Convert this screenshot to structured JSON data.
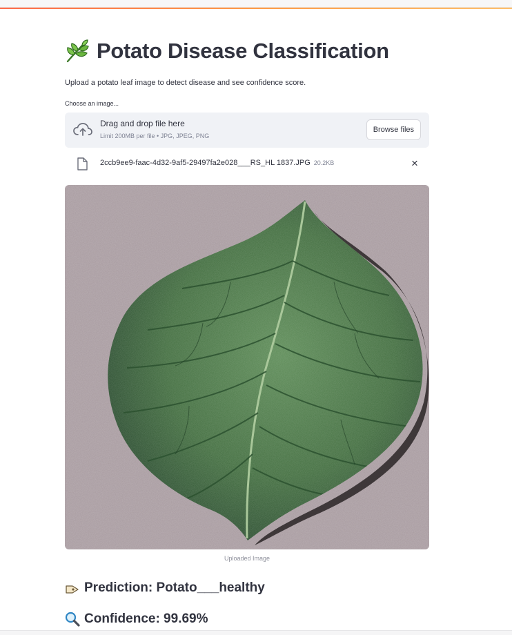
{
  "page": {
    "title": "Potato Disease Classification",
    "title_icon": "herb-leaf-emoji",
    "subtitle": "Upload a potato leaf image to detect disease and see confidence score."
  },
  "uploader": {
    "label": "Choose an image...",
    "dropzone_title": "Drag and drop file here",
    "limit_text": "Limit 200MB per file • JPG, JPEG, PNG",
    "browse_label": "Browse files",
    "cloud_icon": "cloud-upload-icon",
    "file": {
      "name": "2ccb9ee9-faac-4d32-9af5-29497fa2e028___RS_HL 1837.JPG",
      "size": "20.2KB",
      "remove_symbol": "×",
      "icon": "file-icon"
    }
  },
  "image": {
    "caption": "Uploaded Image",
    "content": "potato-leaf-photo"
  },
  "results": {
    "prediction": "Prediction: Potato___healthy",
    "prediction_icon": "label-tag-icon",
    "confidence": "Confidence: 99.69%",
    "confidence_icon": "magnifier-icon"
  },
  "colors": {
    "accent_start": "#ff6b4a",
    "accent_end": "#ffbf6a",
    "dropzone_bg": "#f0f2f6",
    "text": "#31333f",
    "muted": "#808495",
    "leaf": "#3f6b3c",
    "background_surface": "#a89ba0"
  }
}
